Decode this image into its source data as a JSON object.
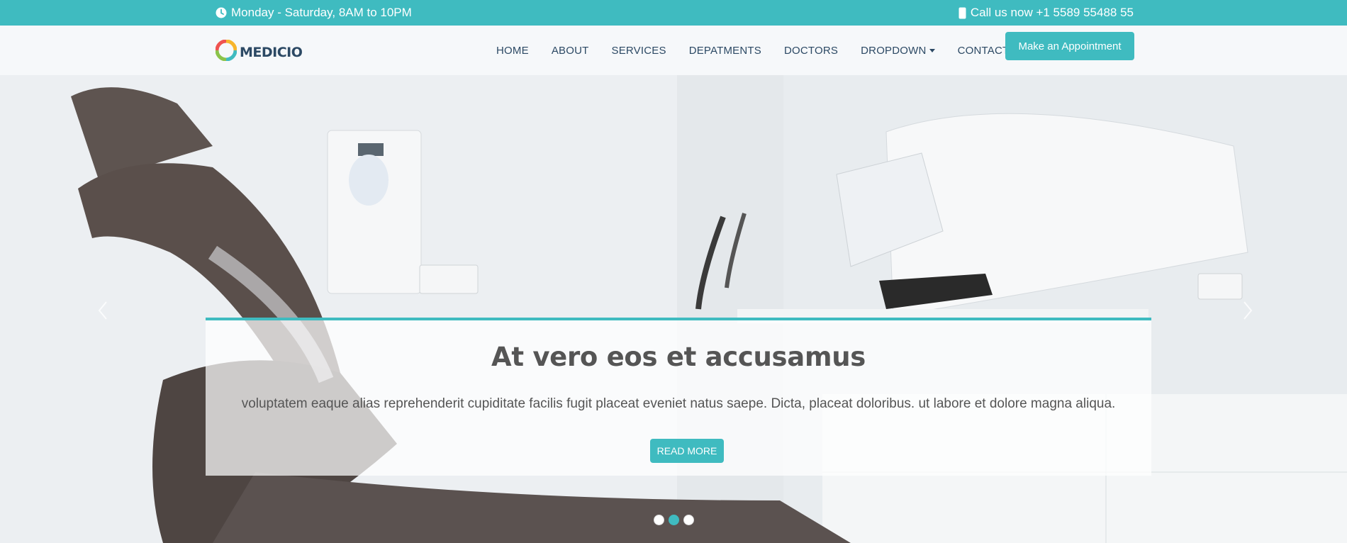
{
  "topbar": {
    "hours": "Monday - Saturday, 8AM to 10PM",
    "phone": "Call us now +1 5589 55488 55"
  },
  "header": {
    "logo_text": "MEDICIO",
    "nav": [
      {
        "label": "HOME"
      },
      {
        "label": "ABOUT"
      },
      {
        "label": "SERVICES"
      },
      {
        "label": "DEPATMENTS"
      },
      {
        "label": "DOCTORS"
      },
      {
        "label": "DROPDOWN"
      },
      {
        "label": "CONTACT"
      }
    ],
    "appointment_button": "Make an Appointment"
  },
  "hero": {
    "title": "At vero eos et accusamus",
    "text": "voluptatem eaque alias reprehenderit cupiditate facilis fugit placeat eveniet natus saepe. Dicta, placeat doloribus. ut labore et dolore magna aliqua.",
    "button": "READ MORE",
    "active_slide": 2,
    "slide_count": 3
  },
  "colors": {
    "accent": "#3fbbc0",
    "heading": "#2c4964"
  }
}
